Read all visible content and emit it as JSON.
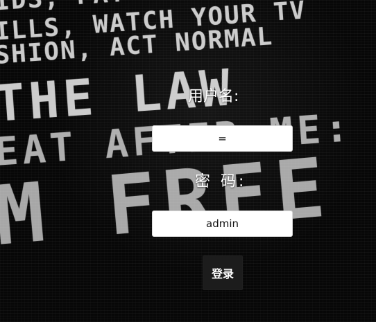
{
  "background": {
    "lines": [
      "IDS, PAY",
      "ILLS, WATCH YOUR TV",
      "SHION, ACT NORMAL",
      "THE LAW",
      "EAT AFTER ME:",
      "M FREE"
    ]
  },
  "login": {
    "username_label": "用户名:",
    "username_value": "=",
    "password_label": "密 码:",
    "password_value": "admin",
    "submit_label": "登录"
  }
}
